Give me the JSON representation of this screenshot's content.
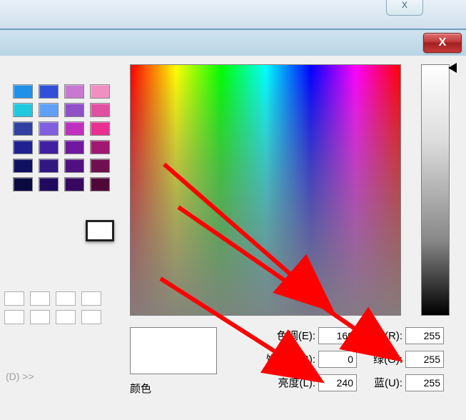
{
  "window": {
    "close_x_label": "x",
    "close_red_label": "X"
  },
  "palette_colors_top": [
    "#2090e8",
    "#3050d8",
    "#c878d0",
    "#f090c0",
    "#20c8e0",
    "#60a0f8",
    "#9050c8",
    "#e050a0",
    "#3040a0",
    "#8060e0",
    "#c030c0",
    "#e83090",
    "#202090",
    "#4020a0",
    "#7018a0",
    "#a01870",
    "#101060",
    "#301880",
    "#501080",
    "#701050",
    "#0a0a40",
    "#200a60",
    "#380860",
    "#500838"
  ],
  "current_color": "#ffffff",
  "palette_colors_bottom": [
    "",
    "",
    "",
    "",
    "",
    "",
    "",
    ""
  ],
  "expand_label": "(D) >>",
  "preview_color": "#ffffff",
  "color_section_label": "颜色",
  "fields": {
    "hue_label": "色调(E):",
    "hue_value": "160",
    "sat_label": "饱和度(S):",
    "sat_value": "0",
    "lum_label": "亮度(L):",
    "lum_value": "240",
    "red_label": "红(R):",
    "red_value": "255",
    "green_label": "绿(G):",
    "green_value": "255",
    "blue_label": "蓝(U):",
    "blue_value": "255"
  }
}
